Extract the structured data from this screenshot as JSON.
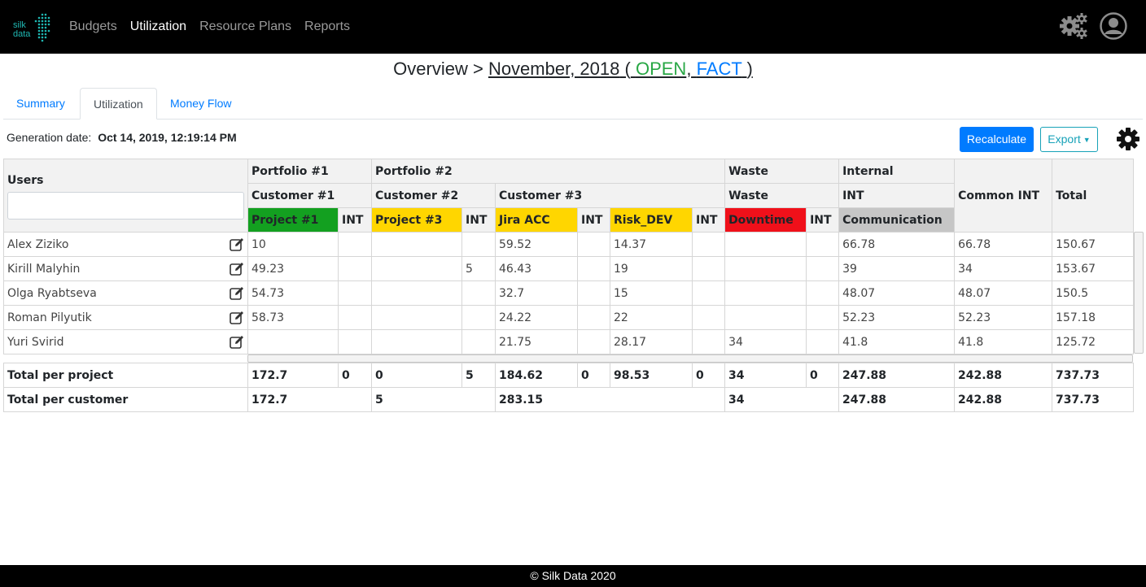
{
  "nav": {
    "logo_text_top": "silk",
    "logo_text_bottom": "data",
    "links": [
      "Budgets",
      "Utilization",
      "Resource Plans",
      "Reports"
    ],
    "active": "Utilization",
    "settings_icon": "gears-icon",
    "avatar_icon": "user-circle-icon"
  },
  "title": {
    "prefix": "Overview >",
    "period": "November, 2018",
    "open_paren": "(",
    "status_open": "OPEN",
    "comma": ",",
    "status_fact": "FACT",
    "close_paren": ")"
  },
  "tabs": [
    "Summary",
    "Utilization",
    "Money Flow"
  ],
  "active_tab": "Utilization",
  "generation": {
    "label": "Generation date:",
    "value": "Oct 14, 2019, 12:19:14 PM"
  },
  "buttons": {
    "recalculate": "Recalculate",
    "export": "Export"
  },
  "table": {
    "users_header": "Users",
    "users_filter_value": "",
    "portfolios": [
      "Portfolio #1",
      "Portfolio #2",
      "Waste",
      "Internal"
    ],
    "customers": [
      "Customer #1",
      "Customer #2",
      "Customer #3",
      "Waste",
      "INT"
    ],
    "common_int": "Common INT",
    "total": "Total",
    "projects": [
      {
        "name": "Project #1",
        "color": "#13a020"
      },
      {
        "name": "INT",
        "color": ""
      },
      {
        "name": "Project #3",
        "color": "#ffd600"
      },
      {
        "name": "INT",
        "color": ""
      },
      {
        "name": "Jira ACC",
        "color": "#ffd600"
      },
      {
        "name": "INT",
        "color": ""
      },
      {
        "name": "Risk_DEV",
        "color": "#ffd600"
      },
      {
        "name": "INT",
        "color": ""
      },
      {
        "name": "Downtime",
        "color": "#f0101a"
      },
      {
        "name": "INT",
        "color": ""
      },
      {
        "name": "Communication",
        "color": "#c6c6c6"
      }
    ],
    "rows": [
      {
        "user": "Alex Ziziko",
        "cells": [
          "10",
          "",
          "",
          "",
          "59.52",
          "",
          "14.37",
          "",
          "",
          "",
          "66.78",
          "66.78",
          "150.67"
        ]
      },
      {
        "user": "Kirill Malyhin",
        "cells": [
          "49.23",
          "",
          "",
          "5",
          "46.43",
          "",
          "19",
          "",
          "",
          "",
          "39",
          "34",
          "153.67"
        ]
      },
      {
        "user": "Olga Ryabtseva",
        "cells": [
          "54.73",
          "",
          "",
          "",
          "32.7",
          "",
          "15",
          "",
          "",
          "",
          "48.07",
          "48.07",
          "150.5"
        ]
      },
      {
        "user": "Roman Pilyutik",
        "cells": [
          "58.73",
          "",
          "",
          "",
          "24.22",
          "",
          "22",
          "",
          "",
          "",
          "52.23",
          "52.23",
          "157.18"
        ]
      },
      {
        "user": "Yuri Svirid",
        "cells": [
          "",
          "",
          "",
          "",
          "21.75",
          "",
          "28.17",
          "",
          "34",
          "",
          "41.8",
          "41.8",
          "125.72"
        ]
      }
    ],
    "total_per_project": {
      "label": "Total per project",
      "cells": [
        "172.7",
        "0",
        "0",
        "5",
        "184.62",
        "0",
        "98.53",
        "0",
        "34",
        "0",
        "247.88",
        "242.88",
        "737.73"
      ]
    },
    "total_per_customer": {
      "label": "Total per customer",
      "cells": [
        "172.7",
        "5",
        "283.15",
        "34",
        "247.88",
        "242.88",
        "737.73"
      ]
    }
  },
  "footer": "© Silk Data 2020"
}
